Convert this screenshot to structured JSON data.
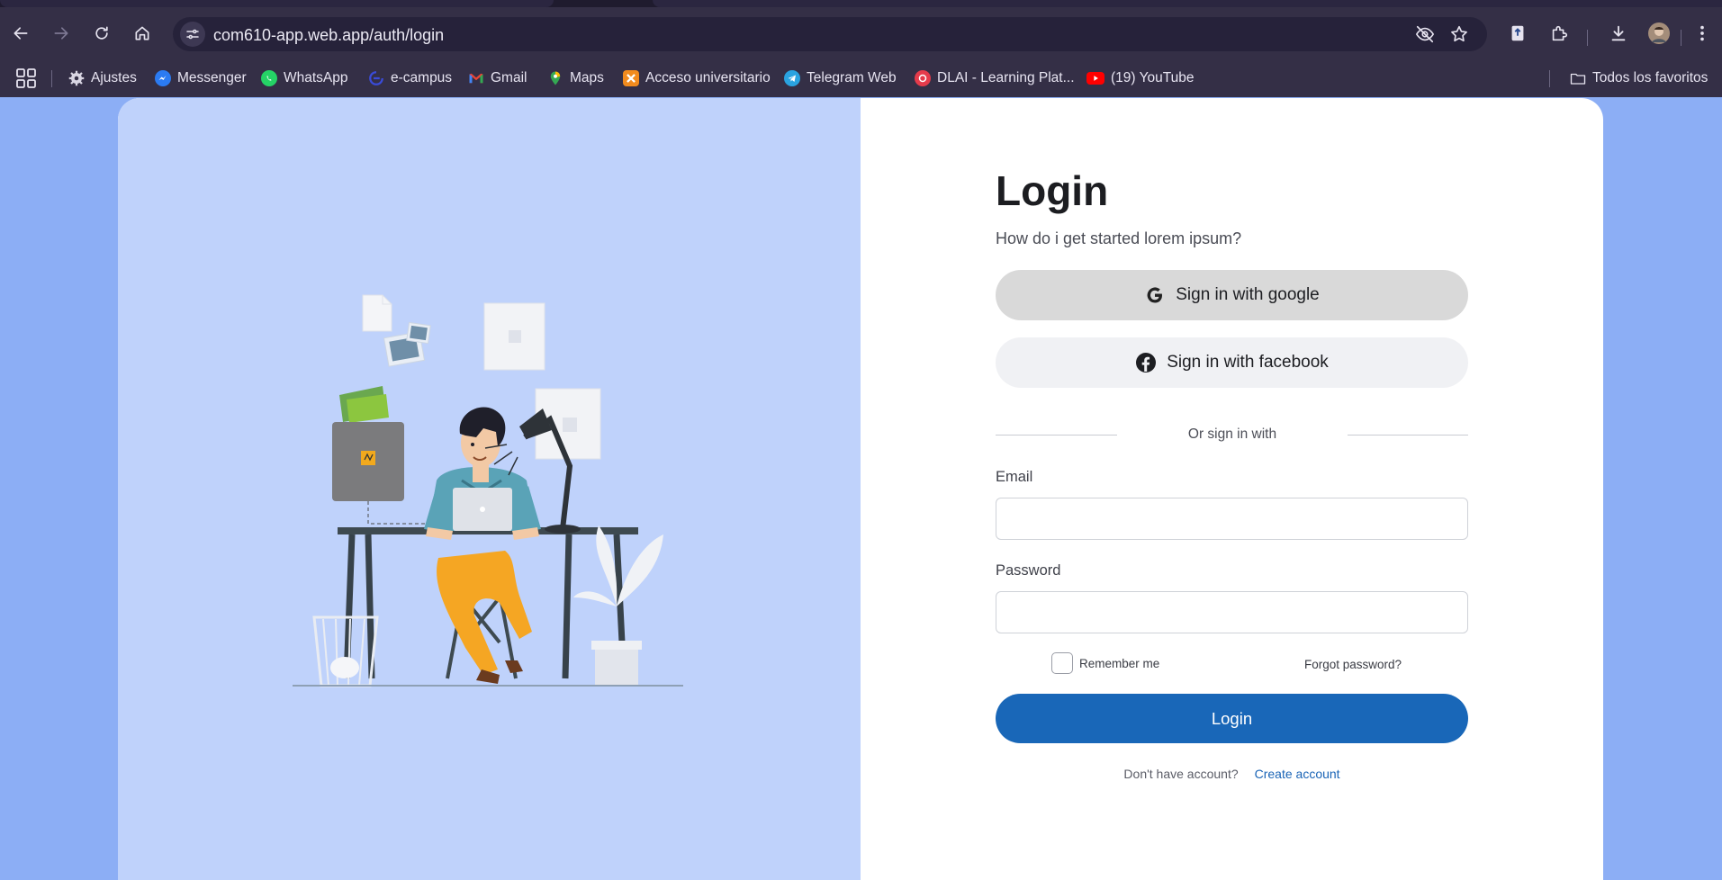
{
  "browser": {
    "url": "com610-app.web.app/auth/login",
    "bookmarks": [
      {
        "label": "Ajustes",
        "icon": "gear-icon"
      },
      {
        "label": "Messenger",
        "icon": "messenger-icon"
      },
      {
        "label": "WhatsApp",
        "icon": "whatsapp-icon"
      },
      {
        "label": "e-campus",
        "icon": "ecampus-icon"
      },
      {
        "label": "Gmail",
        "icon": "gmail-icon"
      },
      {
        "label": "Maps",
        "icon": "maps-icon"
      },
      {
        "label": "Acceso universitario",
        "icon": "xampp-icon"
      },
      {
        "label": "Telegram Web",
        "icon": "telegram-icon"
      },
      {
        "label": "DLAI - Learning Plat...",
        "icon": "dlai-icon"
      },
      {
        "label": "(19) YouTube",
        "icon": "youtube-icon"
      }
    ],
    "all_bookmarks_label": "Todos los favoritos"
  },
  "login": {
    "title": "Login",
    "subtitle": "How do i get started lorem ipsum?",
    "google_label": "Sign in with google",
    "facebook_label": "Sign in with facebook",
    "divider_text": "Or sign in with",
    "email_label": "Email",
    "email_value": "",
    "password_label": "Password",
    "password_value": "",
    "remember_label": "Remember me",
    "forgot_label": "Forgot password?",
    "submit_label": "Login",
    "no_account_text": "Don't have account?",
    "create_account_label": "Create account"
  },
  "colors": {
    "page_bg": "#8caef5",
    "illustration_bg": "#bfd2fb",
    "primary": "#1967b8",
    "google_btn": "#d9d9d9",
    "facebook_btn": "#f0f1f4",
    "browser_chrome": "#342f46"
  }
}
